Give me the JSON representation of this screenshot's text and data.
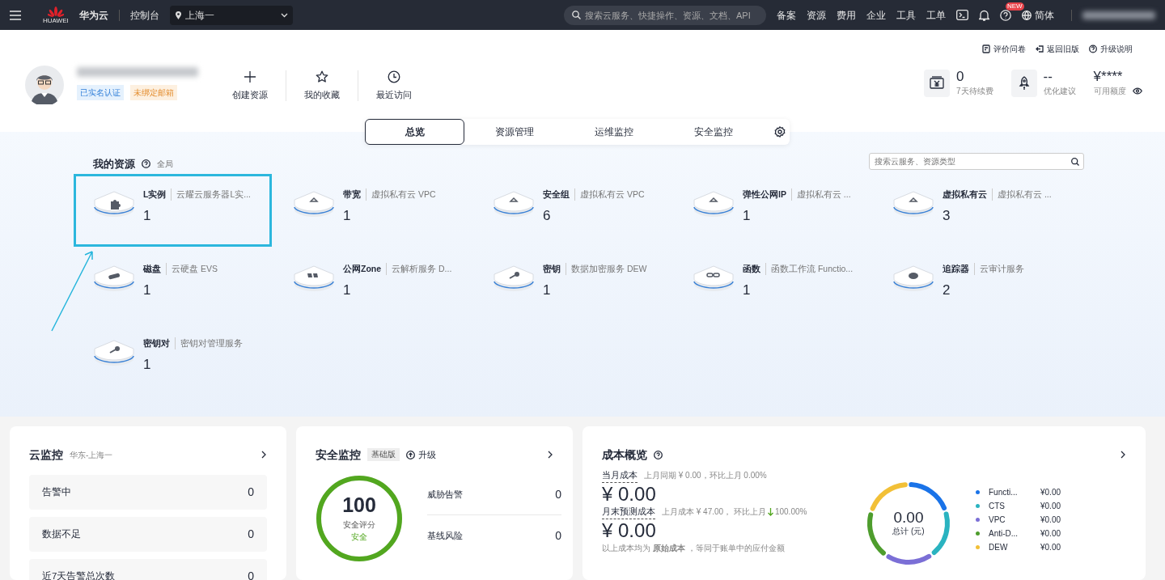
{
  "topbar": {
    "brand": "华为云",
    "logo_caption": "HUAWEI",
    "console": "控制台",
    "region": "上海一",
    "search": {
      "placeholder": "搜索云服务、快捷操作、资源、文档、API"
    },
    "links": [
      "备案",
      "资源",
      "费用",
      "企业",
      "工具",
      "工单"
    ],
    "new_badge": "NEW",
    "language": "简体"
  },
  "profile": {
    "badges": [
      {
        "label": "已实名认证",
        "kind": "verified"
      },
      {
        "label": "未绑定邮箱",
        "kind": "warning"
      }
    ],
    "quick_actions": [
      {
        "label": "创建资源",
        "kind": "plus"
      },
      {
        "label": "我的收藏",
        "kind": "star"
      },
      {
        "label": "最近访问",
        "kind": "clock"
      }
    ]
  },
  "top_links": [
    {
      "label": "评价问卷",
      "kind": "survey"
    },
    {
      "label": "返回旧版",
      "kind": "back"
    },
    {
      "label": "升级说明",
      "kind": "help"
    }
  ],
  "stats": [
    {
      "value": "0",
      "label": "7天待续费",
      "kind": "yen"
    },
    {
      "value": "--",
      "label": "优化建议",
      "kind": "rocket"
    },
    {
      "value": "¥****",
      "label": "可用额度",
      "kind": "plain",
      "eye": true
    }
  ],
  "tabs": [
    {
      "label": "总览",
      "selected": true
    },
    {
      "label": "资源管理",
      "selected": false
    },
    {
      "label": "运维监控",
      "selected": false
    },
    {
      "label": "安全监控",
      "selected": false
    }
  ],
  "resources": {
    "title": "我的资源",
    "scope": "全局",
    "search": {
      "placeholder": "搜索云服务、资源类型"
    },
    "items": [
      {
        "name": "L实例",
        "desc": "云耀云服务器L实...",
        "count": "1",
        "kind": "puzzle",
        "highlighted": true
      },
      {
        "name": "带宽",
        "desc": "虚拟私有云 VPC",
        "count": "1",
        "kind": "triangle",
        "highlighted": false
      },
      {
        "name": "安全组",
        "desc": "虚拟私有云 VPC",
        "count": "6",
        "kind": "triangle",
        "highlighted": false
      },
      {
        "name": "弹性公网IP",
        "desc": "虚拟私有云 ...",
        "count": "1",
        "kind": "triangle",
        "highlighted": false
      },
      {
        "name": "虚拟私有云",
        "desc": "虚拟私有云 ...",
        "count": "3",
        "kind": "triangle",
        "highlighted": false
      },
      {
        "name": "磁盘",
        "desc": "云硬盘 EVS",
        "count": "1",
        "kind": "disk",
        "highlighted": false
      },
      {
        "name": "公网Zone",
        "desc": "云解析服务 D...",
        "count": "1",
        "kind": "dns",
        "highlighted": false
      },
      {
        "name": "密钥",
        "desc": "数据加密服务 DEW",
        "count": "1",
        "kind": "key",
        "highlighted": false
      },
      {
        "name": "函数",
        "desc": "函数工作流 Functio...",
        "count": "1",
        "kind": "link",
        "highlighted": false
      },
      {
        "name": "追踪器",
        "desc": "云审计服务",
        "count": "2",
        "kind": "cloud",
        "highlighted": false
      },
      {
        "name": "密钥对",
        "desc": "密钥对管理服务",
        "count": "1",
        "kind": "key",
        "highlighted": false
      }
    ]
  },
  "monitor": {
    "title": "云监控",
    "region": "华东-上海一",
    "rows": [
      {
        "label": "告警中",
        "value": "0"
      },
      {
        "label": "数据不足",
        "value": "0"
      },
      {
        "label": "近7天告警总次数",
        "value": "0"
      }
    ]
  },
  "security": {
    "title": "安全监控",
    "edition": "基础版",
    "upgrade": "升级",
    "score": "100",
    "score_label": "安全评分",
    "status": "安全",
    "level": 1,
    "rows": [
      {
        "label": "威胁告警",
        "value": "0"
      },
      {
        "label": "基线风险",
        "value": "0"
      }
    ]
  },
  "cost": {
    "title": "成本概览",
    "current_label": "当月成本",
    "current_compare": "上月同期 ¥ 0.00，环比上月  0.00%",
    "current_value": "¥ 0.00",
    "forecast_label": "月末预测成本",
    "forecast_compare": "上月成本 ¥ 47.00，  环比上月",
    "forecast_change": "100.00%",
    "forecast_value": "¥ 0.00",
    "note": "以上成本均为 **原始成本** ，等同于账单中的应付金额",
    "total": "0.00",
    "total_label": "总计 (元)",
    "legend": [
      {
        "name": "Functi...",
        "value": "¥0.00",
        "color": "#1a73e8"
      },
      {
        "name": "CTS",
        "value": "¥0.00",
        "color": "#2ab3c0"
      },
      {
        "name": "VPC",
        "value": "¥0.00",
        "color": "#7b6fd6"
      },
      {
        "name": "Anti-D...",
        "value": "¥0.00",
        "color": "#4e9d2d"
      },
      {
        "name": "DEW",
        "value": "¥0.00",
        "color": "#f2c037"
      }
    ]
  }
}
